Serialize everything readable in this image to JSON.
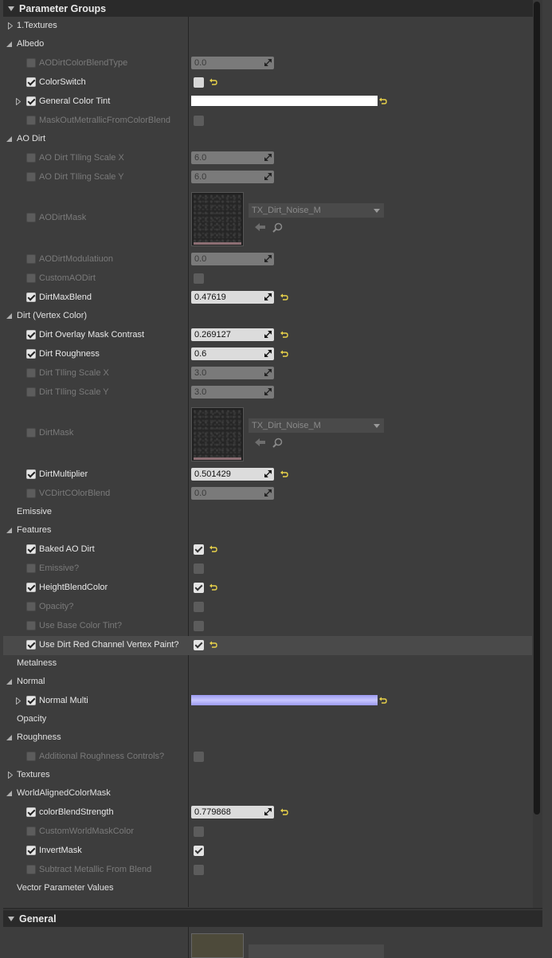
{
  "panel": {
    "title": "Parameter Groups",
    "general_title": "General"
  },
  "groups": [
    {
      "label": "1.Textures",
      "expanded": false
    },
    {
      "label": "Albedo",
      "expanded": true
    },
    {
      "label": "AO Dirt",
      "expanded": true
    },
    {
      "label": "Dirt (Vertex Color)",
      "expanded": true
    },
    {
      "label": "Emissive",
      "expanded": null
    },
    {
      "label": "Features",
      "expanded": true
    },
    {
      "label": "Metalness",
      "expanded": null
    },
    {
      "label": "Normal",
      "expanded": true
    },
    {
      "label": "Opacity",
      "expanded": null
    },
    {
      "label": "Roughness",
      "expanded": true
    },
    {
      "label": "Textures",
      "expanded": false
    },
    {
      "label": "WorldAlignedColorMask",
      "expanded": true
    },
    {
      "label": "Vector Parameter Values",
      "expanded": null
    }
  ],
  "params": {
    "albedo": [
      {
        "label": "AODirtColorBlendType",
        "enabled": false,
        "value": "0.0"
      },
      {
        "label": "ColorSwitch",
        "enabled": true,
        "checked": false
      },
      {
        "label": "General Color Tint",
        "enabled": true,
        "color": "#ffffff"
      },
      {
        "label": "MaskOutMetrallicFromColorBlend",
        "enabled": false,
        "checked": false
      }
    ],
    "ao_dirt": [
      {
        "label": "AO Dirt TIling Scale X",
        "enabled": false,
        "value": "6.0"
      },
      {
        "label": "AO Dirt TIling Scale Y",
        "enabled": false,
        "value": "6.0"
      },
      {
        "label": "AODirtMask",
        "enabled": false,
        "texture": "TX_Dirt_Noise_M"
      },
      {
        "label": "AODirtModulatiuon",
        "enabled": false,
        "value": "0.0"
      },
      {
        "label": "CustomAODirt",
        "enabled": false,
        "checked": false
      },
      {
        "label": "DirtMaxBlend",
        "enabled": true,
        "value": "0.47619"
      }
    ],
    "dirt_vertex": [
      {
        "label": "Dirt Overlay Mask Contrast",
        "enabled": true,
        "value": "0.269127"
      },
      {
        "label": "Dirt Roughness",
        "enabled": true,
        "value": "0.6"
      },
      {
        "label": "Dirt TIling Scale X",
        "enabled": false,
        "value": "3.0"
      },
      {
        "label": "Dirt TIling Scale Y",
        "enabled": false,
        "value": "3.0"
      },
      {
        "label": "DirtMask",
        "enabled": false,
        "texture": "TX_Dirt_Noise_M"
      },
      {
        "label": "DirtMultiplier",
        "enabled": true,
        "value": "0.501429"
      },
      {
        "label": "VCDirtCOlorBlend",
        "enabled": false,
        "value": "0.0"
      }
    ],
    "features": [
      {
        "label": "Baked AO Dirt",
        "enabled": true,
        "checked": true
      },
      {
        "label": "Emissive?",
        "enabled": false,
        "checked": false
      },
      {
        "label": "HeightBlendColor",
        "enabled": true,
        "checked": true
      },
      {
        "label": "Opacity?",
        "enabled": false,
        "checked": false
      },
      {
        "label": "Use Base Color Tint?",
        "enabled": false,
        "checked": false
      },
      {
        "label": "Use Dirt Red Channel Vertex Paint?",
        "enabled": true,
        "checked": true
      }
    ],
    "normal": [
      {
        "label": "Normal Multi",
        "enabled": true,
        "color": "#b3b1ff"
      }
    ],
    "roughness": [
      {
        "label": "Additional Roughness Controls?",
        "enabled": false,
        "checked": false
      }
    ],
    "world_aligned": [
      {
        "label": "colorBlendStrength",
        "enabled": true,
        "value": "0.779868"
      },
      {
        "label": "CustomWorldMaskColor",
        "enabled": false,
        "checked": false
      },
      {
        "label": "InvertMask",
        "enabled": true,
        "checked": true
      },
      {
        "label": "Subtract Metallic From Blend",
        "enabled": false,
        "checked": false
      }
    ]
  },
  "colors": {
    "panel_bg": "#3d3d3d",
    "header_bg": "#2a2a2a",
    "reset_arrow": "#e8d24a",
    "normal_tint": "#b3b1ff"
  }
}
